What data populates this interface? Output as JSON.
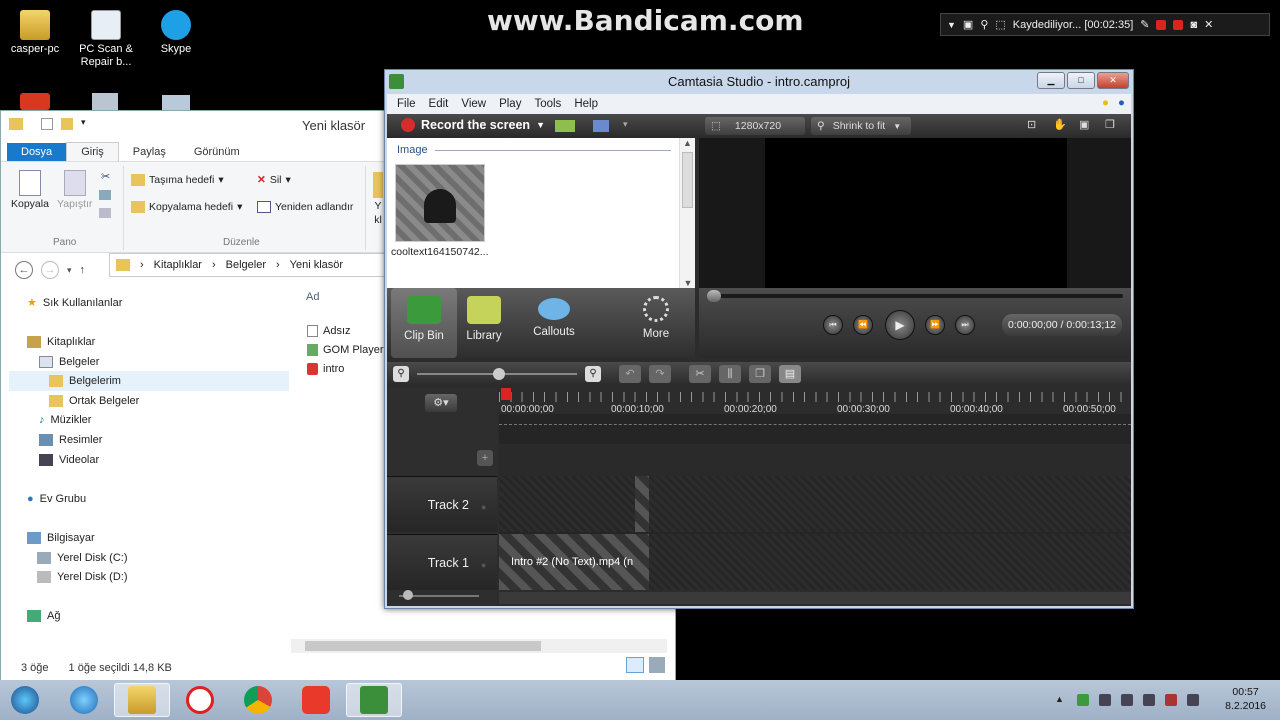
{
  "desktop": {
    "icons": [
      {
        "label": "casper-pc"
      },
      {
        "label": "PC Scan & Repair b..."
      },
      {
        "label": "Skype"
      }
    ]
  },
  "watermark": "www.Bandicam.com",
  "bandicam": {
    "status": "Kaydediliyor... [00:02:35]"
  },
  "explorer": {
    "title": "Yeni klasör",
    "tabs": [
      "Dosya",
      "Giriş",
      "Paylaş",
      "Görünüm"
    ],
    "ribbon": {
      "copy": "Kopyala",
      "paste": "Yapıştır",
      "move_to": "Taşıma hedefi",
      "copy_to": "Kopyalama hedefi",
      "delete": "Sil",
      "rename": "Yeniden adlandır",
      "group_clipboard": "Pano",
      "group_organize": "Düzenle",
      "new_short": "Y",
      "new_short2": "kl"
    },
    "breadcrumb": [
      "Kitaplıklar",
      "Belgeler",
      "Yeni klasör"
    ],
    "tree": [
      {
        "label": "Sık Kullanılanlar"
      },
      {
        "label": ""
      },
      {
        "label": "Kitaplıklar"
      },
      {
        "label": "Belgeler"
      },
      {
        "label": "Belgelerim"
      },
      {
        "label": "Ortak Belgeler"
      },
      {
        "label": "Müzikler"
      },
      {
        "label": "Resimler"
      },
      {
        "label": "Videolar"
      },
      {
        "label": ""
      },
      {
        "label": "Ev Grubu"
      },
      {
        "label": ""
      },
      {
        "label": "Bilgisayar"
      },
      {
        "label": "Yerel Disk (C:)"
      },
      {
        "label": "Yerel Disk (D:)"
      },
      {
        "label": ""
      },
      {
        "label": "Ağ"
      }
    ],
    "column_header": "Ad",
    "files": [
      "Adsız",
      "GOM Player",
      "intro"
    ],
    "status_count": "3 öğe",
    "status_selected": "1 öğe seçildi  14,8 KB"
  },
  "camtasia": {
    "title": "Camtasia Studio - intro.camproj",
    "menu": [
      "File",
      "Edit",
      "View",
      "Play",
      "Tools",
      "Help"
    ],
    "record_button": "Record the screen",
    "resolution": "1280x720",
    "zoom": "Shrink to fit",
    "bin_section": "Image",
    "bin_item": "cooltext164150742...",
    "tabs": [
      "Clip Bin",
      "Library",
      "Callouts",
      "More"
    ],
    "timecode": "0:00:00;00 / 0:00:13;12",
    "ruler_ticks": [
      "00:00:00;00",
      "00:00:10;00",
      "00:00:20;00",
      "00:00:30;00",
      "00:00:40;00",
      "00:00:50;00"
    ],
    "tracks": [
      {
        "name": "Track 2"
      },
      {
        "name": "Track 1",
        "clip": "Intro #2  (No Text).mp4 (n"
      }
    ]
  },
  "taskbar": {
    "time": "00:57",
    "date": "8.2.2016"
  }
}
